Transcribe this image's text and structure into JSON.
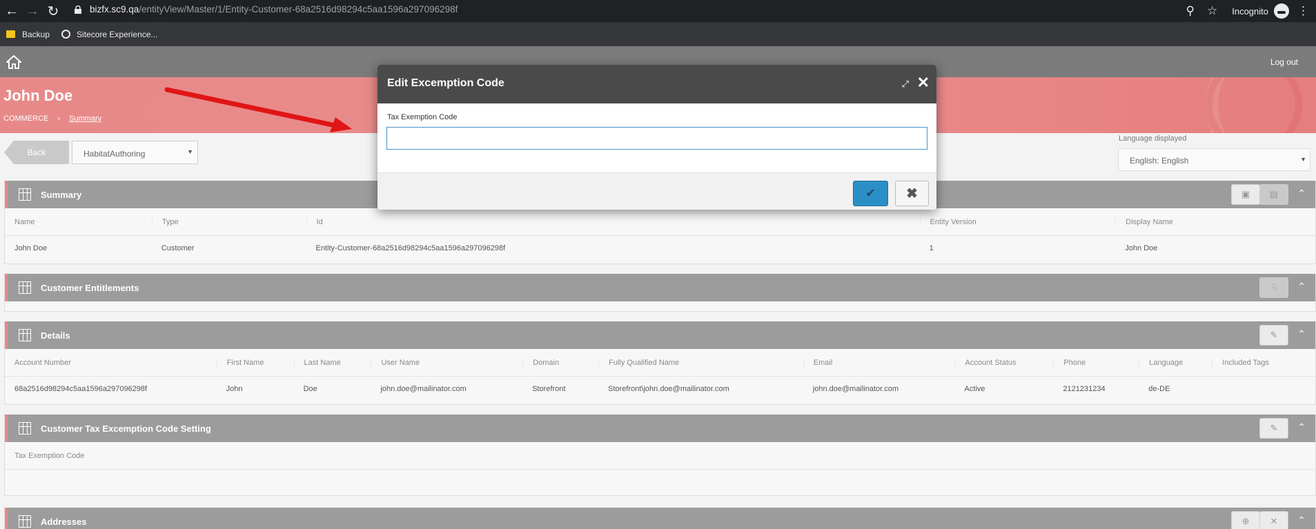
{
  "browser": {
    "url_host": "bizfx.sc9.qa",
    "url_path": "/entityView/Master/1/Entity-Customer-68a2516d98294c5aa1596a297096298f",
    "profile_label": "Incognito",
    "bookmarks": [
      {
        "label": "Backup",
        "icon": "folder-icon"
      },
      {
        "label": "Sitecore Experience...",
        "icon": "globe-icon"
      }
    ]
  },
  "app": {
    "logout_label": "Log out",
    "page_title": "John Doe",
    "breadcrumb": {
      "root": "COMMERCE",
      "separator": "›",
      "current": "Summary"
    },
    "back_label": "Back",
    "environment_select": "HabitatAuthoring",
    "language_label": "Language displayed",
    "language_select": "English: English"
  },
  "panels": {
    "summary": {
      "title": "Summary",
      "columns": [
        "Name",
        "Type",
        "Id",
        "Entity Version",
        "Display Name"
      ],
      "row": [
        "John Doe",
        "Customer",
        "Entity-Customer-68a2516d98294c5aa1596a297096298f",
        "1",
        "John Doe"
      ]
    },
    "entitlements": {
      "title": "Customer Entitlements"
    },
    "details": {
      "title": "Details",
      "columns": [
        "Account Number",
        "First Name",
        "Last Name",
        "User Name",
        "Domain",
        "Fully Qualified Name",
        "Email",
        "Account Status",
        "Phone",
        "Language",
        "Included Tags"
      ],
      "row": [
        "68a2516d98294c5aa1596a297096298f",
        "John",
        "Doe",
        "john.doe@mailinator.com",
        "Storefront",
        "Storefront\\john.doe@mailinator.com",
        "john.doe@mailinator.com",
        "Active",
        "2121231234",
        "de-DE",
        ""
      ]
    },
    "tax": {
      "title": "Customer Tax Excemption Code Setting",
      "column": "Tax Exemption Code"
    },
    "addresses": {
      "title": "Addresses"
    }
  },
  "modal": {
    "title": "Edit Excemption Code",
    "field_label": "Tax Exemption Code",
    "field_value": ""
  },
  "colors": {
    "accent_pink": "#e88989",
    "panel_header": "#9c9c9c",
    "primary_blue": "#2b8fc6",
    "annotation_red": "#e01515"
  }
}
